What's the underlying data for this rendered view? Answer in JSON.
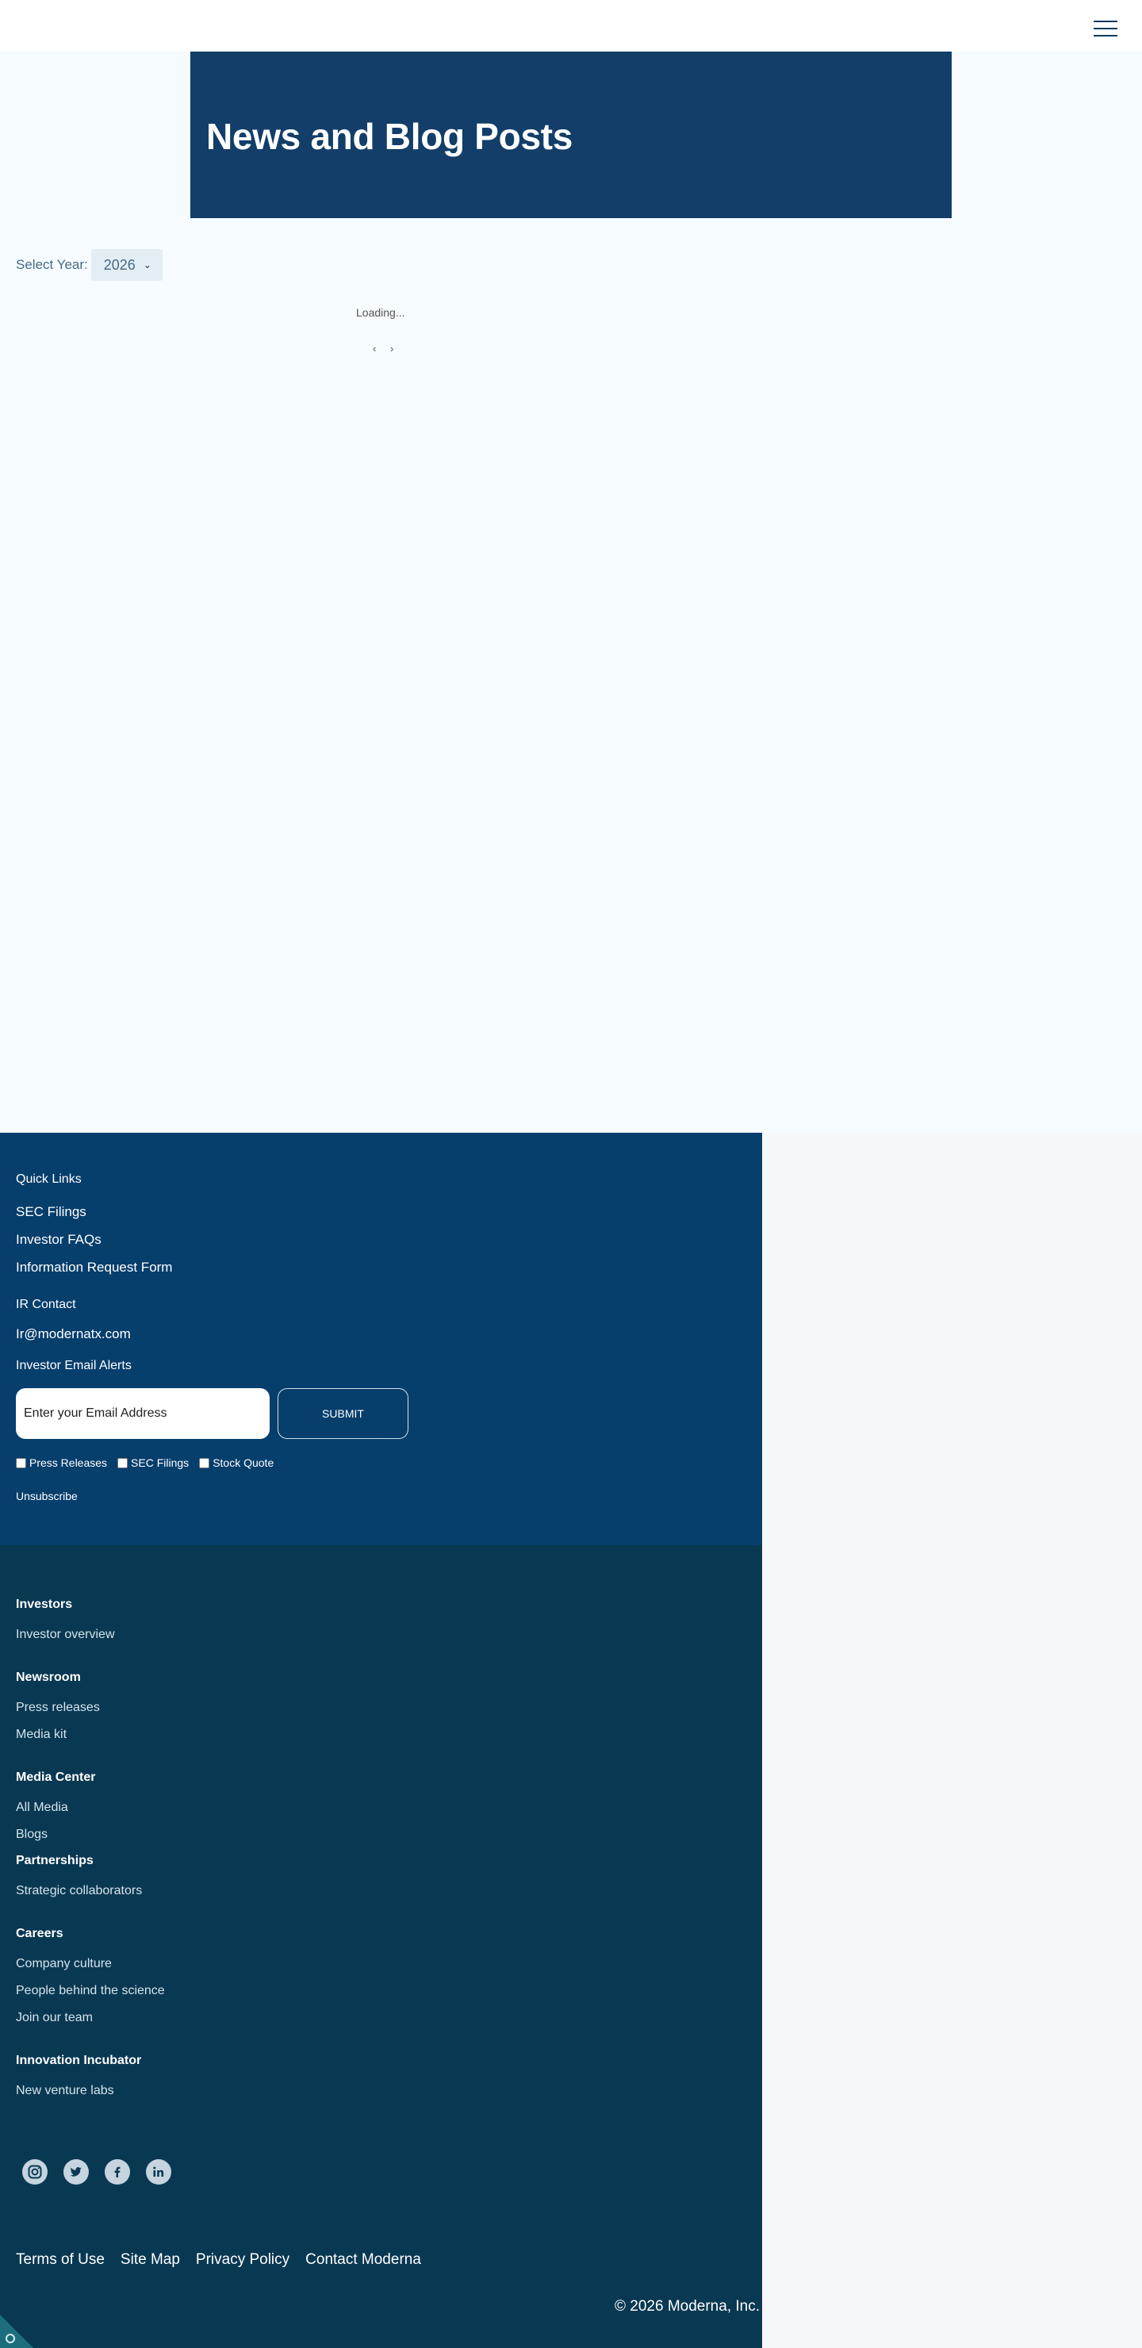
{
  "header": {
    "menu_icon": "hamburger-menu-icon"
  },
  "hero": {
    "title": "News and Blog Posts"
  },
  "filter": {
    "label": "Select Year:",
    "selected_year": "2026"
  },
  "content": {
    "loading_text": "Loading...",
    "prev": "‹",
    "next": "›"
  },
  "footer_top": {
    "quick_links_heading": "Quick Links",
    "quick_links": [
      "SEC Filings",
      "Investor FAQs",
      "Information Request Form"
    ],
    "ir_contact_heading": "IR Contact",
    "ir_email": "Ir@modernatx.com",
    "alerts_heading": "Investor Email Alerts",
    "email_placeholder": "Enter your Email Address",
    "submit_label": "SUBMIT",
    "checkboxes": [
      "Press Releases",
      "SEC Filings",
      "Stock Quote"
    ],
    "unsubscribe": "Unsubscribe"
  },
  "footer_nav": {
    "investors": {
      "heading": "Investors",
      "links": [
        "Investor overview"
      ]
    },
    "newsroom": {
      "heading": "Newsroom",
      "links": [
        "Press releases",
        "Media kit"
      ]
    },
    "media_center": {
      "heading": "Media Center",
      "links": [
        "All Media",
        "Blogs"
      ]
    },
    "partnerships": {
      "heading": "Partnerships",
      "links": [
        "Strategic collaborators"
      ]
    },
    "careers": {
      "heading": "Careers",
      "links": [
        "Company culture",
        "People behind the science",
        "Join our team"
      ]
    },
    "innovation": {
      "heading": "Innovation Incubator",
      "links": [
        "New venture labs"
      ]
    }
  },
  "social": [
    "instagram-icon",
    "twitter-icon",
    "facebook-icon",
    "linkedin-icon"
  ],
  "legal": [
    "Terms of Use",
    "Site Map",
    "Privacy Policy",
    "Contact Moderna"
  ],
  "copyright": "© 2026 Moderna, Inc.",
  "colors": {
    "hero": "#123e69",
    "footer_top": "#063e6c",
    "footer_bottom": "#093852",
    "page_bg": "#f5fbfe"
  }
}
